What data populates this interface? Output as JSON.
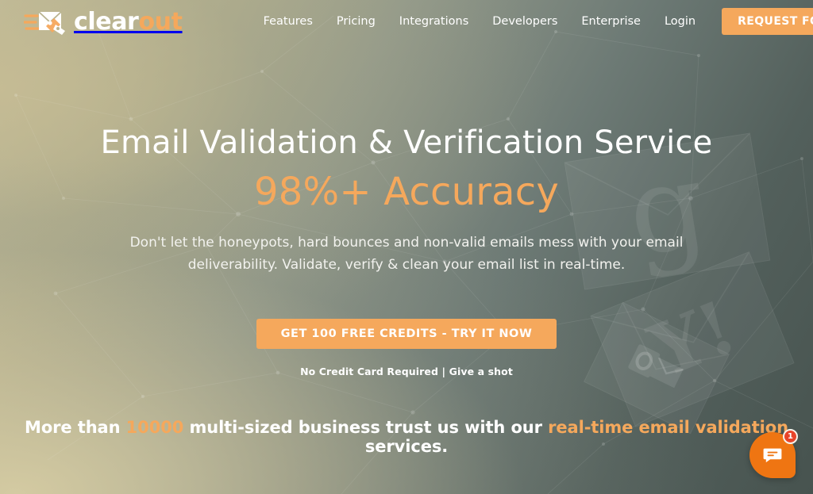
{
  "theme": {
    "accent_orange": "#f5a85c",
    "chat_orange": "#ef7512",
    "badge_red": "#e8442a",
    "text_white": "#ffffff",
    "bg_gradient_start": "#cfc6a0",
    "bg_gradient_end": "#47534f"
  },
  "header": {
    "logo": {
      "icon": "envelope-speed-icon",
      "text_primary": "clear",
      "text_accent": "out"
    },
    "nav": [
      {
        "label": "Features"
      },
      {
        "label": "Pricing"
      },
      {
        "label": "Integrations"
      },
      {
        "label": "Developers"
      },
      {
        "label": "Enterprise"
      },
      {
        "label": "Login"
      }
    ],
    "demo_button": "REQUEST FOR DEMO"
  },
  "hero": {
    "title": "Email Validation & Verification Service",
    "accuracy": "98%+ Accuracy",
    "description": "Don't let the honeypots, hard bounces and non-valid emails mess with your email deliverability. Validate, verify & clean your email list in real-time.",
    "cta_button": "GET 100 FREE CREDITS - TRY IT NOW",
    "cta_note": "No Credit Card Required | Give a shot",
    "trust": {
      "prefix": "More than ",
      "count": "10000",
      "middle": " multi-sized business trust us with our ",
      "highlight": "real-time email validation",
      "suffix": " services."
    }
  },
  "background": {
    "cards": [
      {
        "glyph": "g",
        "brand": "google-envelope-card"
      },
      {
        "glyph": "Y!",
        "brand": "yahoo-envelope-card"
      },
      {
        "glyph": "",
        "brand": "outlook-envelope-card"
      }
    ]
  },
  "chat": {
    "icon": "chat-bubble-icon",
    "badge_count": "1"
  }
}
